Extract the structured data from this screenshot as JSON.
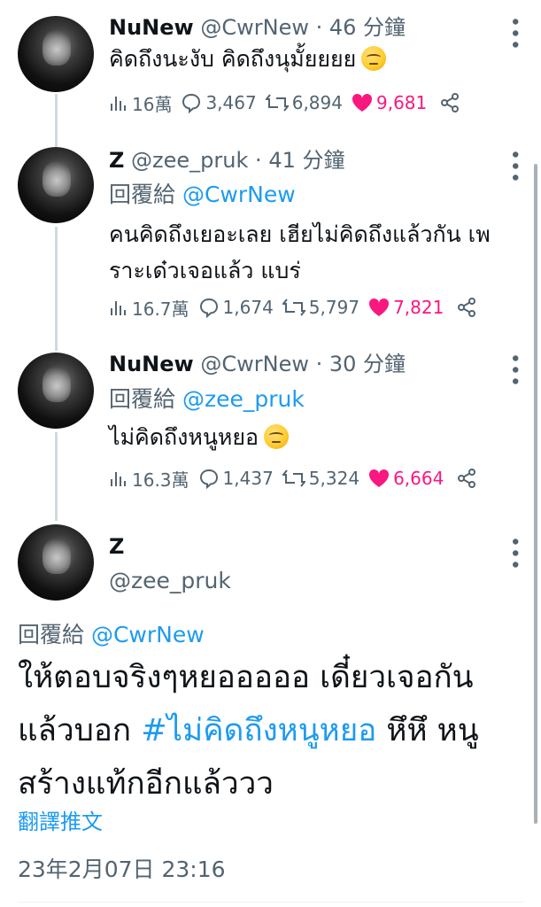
{
  "tweets": [
    {
      "name": "NuNew",
      "handle": "@CwrNew",
      "time": "46 分鐘",
      "reply_prefix": "",
      "reply_to": "",
      "text": "คิดถึงนะงับ คิดถึงนุมั้ยยยย",
      "emoji": "rolling-eyes-emoji",
      "views": "16萬",
      "replies": "3,467",
      "retweets": "6,894",
      "likes": "9,681"
    },
    {
      "name": "Z",
      "handle": "@zee_pruk",
      "time": "41 分鐘",
      "reply_prefix": "回覆給",
      "reply_to": "@CwrNew",
      "text": "คนคิดถึงเยอะเลย เฮียไม่คิดถึงแล้วกัน เพราะเด๋วเจอแล้ว แบร่",
      "emoji": "",
      "views": "16.7萬",
      "replies": "1,674",
      "retweets": "5,797",
      "likes": "7,821"
    },
    {
      "name": "NuNew",
      "handle": "@CwrNew",
      "time": "30 分鐘",
      "reply_prefix": "回覆給",
      "reply_to": "@zee_pruk",
      "text": "ไม่คิดถึงหนูหยอ",
      "emoji": "rolling-eyes-emoji",
      "views": "16.3萬",
      "replies": "1,437",
      "retweets": "5,324",
      "likes": "6,664"
    }
  ],
  "main_tweet": {
    "name": "Z",
    "handle": "@zee_pruk",
    "reply_prefix": "回覆給",
    "reply_to": "@CwrNew",
    "text_part1": "ให้ตอบจริงๆหยอออออ เดี๋ยวเจอกันแล้วบอก",
    "hashtag": "#ไม่คิดถึงหนูหยอ",
    "text_part2": "หึหึ หนูสร้างแท้กอีกแล้ววว",
    "translate": "翻譯推文",
    "timestamp": "23年2月07日 23:16"
  },
  "colors": {
    "accent": "#1d9bf0",
    "like": "#f91880",
    "secondary_text": "#536471",
    "thread_line": "#cfd9de"
  },
  "icons": [
    "views-icon",
    "reply-icon",
    "retweet-icon",
    "like-icon",
    "share-icon",
    "more-icon"
  ]
}
